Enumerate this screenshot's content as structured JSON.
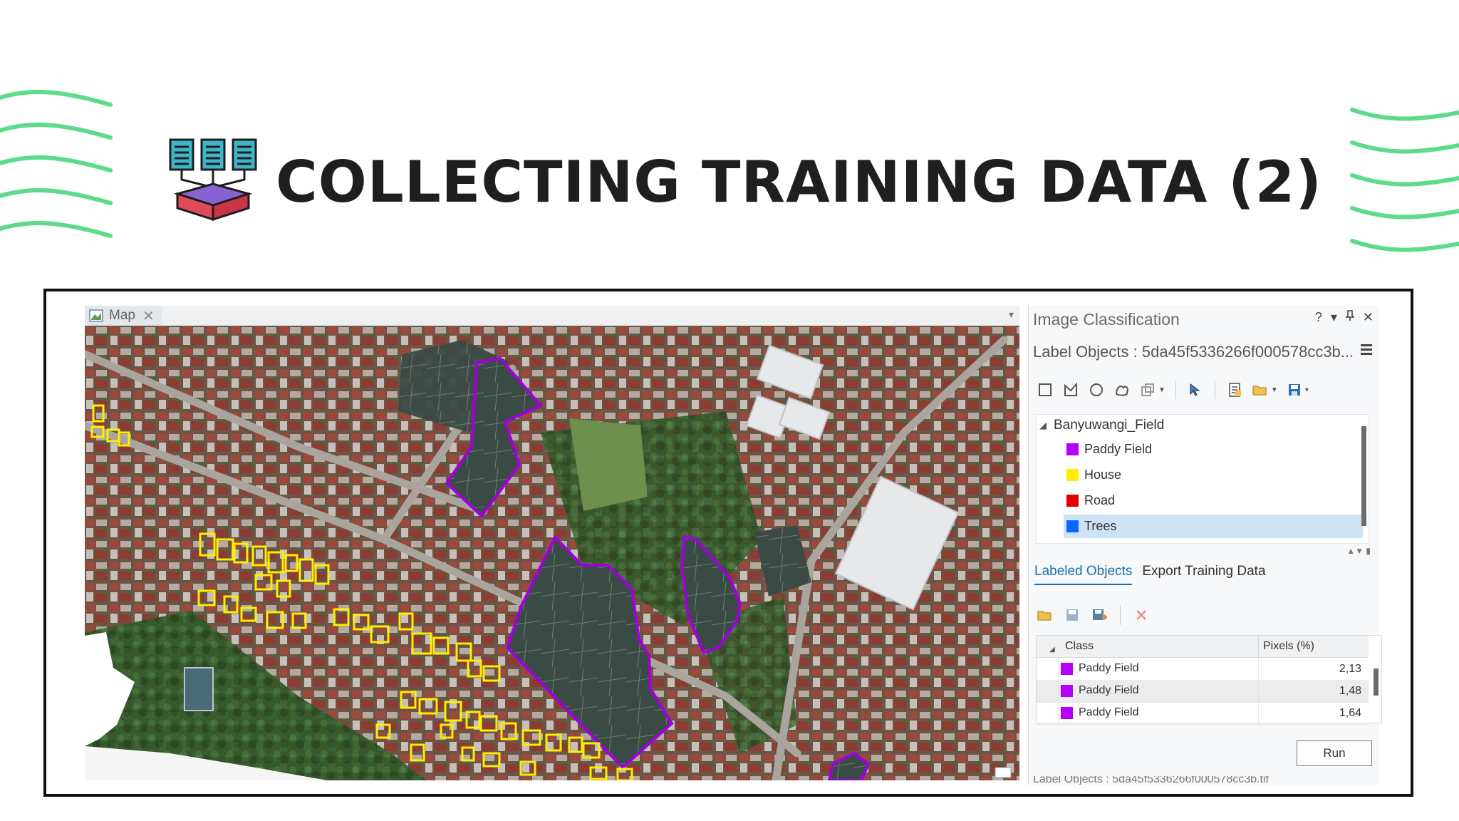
{
  "slide": {
    "title": "COLLECTING TRAINING DATA (2)",
    "accent_color": "#5ddb8b",
    "icon": "dataset-stack-icon"
  },
  "map": {
    "tab_label": "Map",
    "tab_close": "✕",
    "menu_chevron": "▾",
    "legend_colors": {
      "paddy_field": "#a000e0",
      "house": "#ffee00"
    }
  },
  "panel": {
    "title": "Image Classification",
    "controls": {
      "help": "?",
      "menu": "▾",
      "pin": "📌",
      "close": "✕"
    },
    "schema_title": "Label Objects : 5da45f5336266f000578cc3b...",
    "tree": {
      "root": "Banyuwangi_Field",
      "classes": [
        {
          "label": "Paddy Field",
          "color": "#b400ff"
        },
        {
          "label": "House",
          "color": "#ffee00"
        },
        {
          "label": "Road",
          "color": "#e00000"
        },
        {
          "label": "Trees",
          "color": "#0a66ff"
        }
      ],
      "selected": "Trees"
    },
    "tabs": [
      "Labeled Objects",
      "Export Training Data"
    ],
    "active_tab": "Labeled Objects",
    "grid": {
      "columns": [
        "Class",
        "Pixels (%)"
      ],
      "rows": [
        {
          "class": "Paddy Field",
          "pixels": "2,13",
          "color": "#b400ff"
        },
        {
          "class": "Paddy Field",
          "pixels": "1,48",
          "color": "#b400ff"
        },
        {
          "class": "Paddy Field",
          "pixels": "1,64",
          "color": "#b400ff"
        }
      ]
    },
    "run_label": "Run",
    "status_text": "Label Objects : 5da45f5336266f000578cc3b.tif"
  }
}
